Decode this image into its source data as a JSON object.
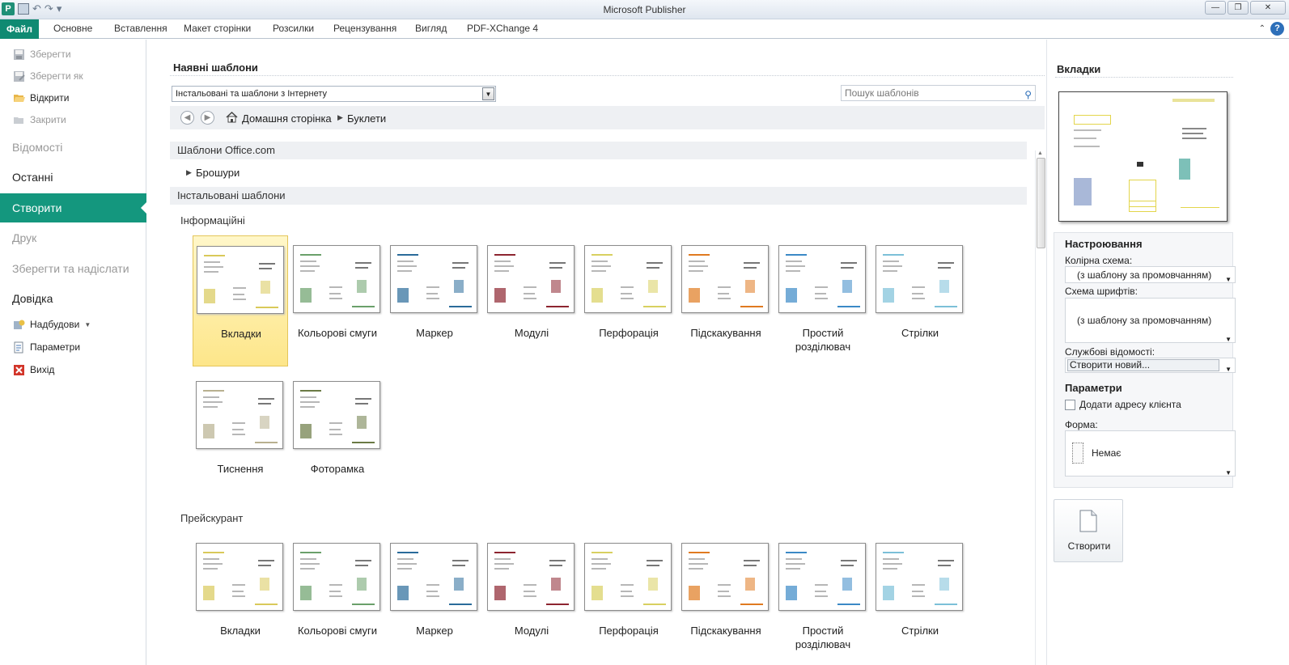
{
  "window": {
    "title": "Microsoft Publisher"
  },
  "ribbon": {
    "file_tab": "Файл",
    "tabs": [
      "Основне",
      "Вставлення",
      "Макет сторінки",
      "Розсилки",
      "Рецензування",
      "Вигляд",
      "PDF-XChange 4"
    ]
  },
  "leftnav": {
    "save": "Зберегти",
    "save_as": "Зберегти як",
    "open": "Відкрити",
    "close": "Закрити",
    "info": "Відомості",
    "recent": "Останні",
    "new": "Створити",
    "print": "Друк",
    "save_send": "Зберегти та надіслати",
    "help": "Довідка",
    "addins": "Надбудови",
    "options": "Параметри",
    "exit": "Вихід"
  },
  "main": {
    "title": "Наявні шаблони",
    "source_select": "Інстальовані та шаблони з Інтернету",
    "search_placeholder": "Пошук шаблонів",
    "breadcrumb": {
      "home": "Домашня сторінка",
      "current": "Буклети"
    },
    "office_section": "Шаблони Office.com",
    "brochures": "Брошури",
    "installed_section": "Інстальовані шаблони",
    "group_info": "Інформаційні",
    "group_price": "Прейскурант",
    "templates_info": [
      "Вкладки",
      "Кольорові смуги",
      "Маркер",
      "Модулі",
      "Перфорація",
      "Підскакування",
      "Простий розділювач",
      "Стрілки",
      "Тиснення",
      "Фоторамка"
    ],
    "templates_price": [
      "Вкладки",
      "Кольорові смуги",
      "Маркер",
      "Модулі",
      "Перфорація",
      "Підскакування",
      "Простий розділювач",
      "Стрілки"
    ],
    "selected_template": "Вкладки"
  },
  "rightpanel": {
    "title": "Вкладки",
    "settings_head": "Настроювання",
    "color_scheme_label": "Колірна схема:",
    "color_scheme_value": "(з шаблону за промовчанням)",
    "font_scheme_label": "Схема шрифтів:",
    "font_scheme_value": "(з шаблону за промовчанням)",
    "business_info_label": "Службові відомості:",
    "business_info_value": "Створити новий...",
    "params_head": "Параметри",
    "customer_address": "Додати адресу клієнта",
    "form_label": "Форма:",
    "form_value": "Немає",
    "create_button": "Створити"
  },
  "colors": {
    "accent": "#14977e",
    "file_tab": "#0f8a72",
    "selection": "#fde68a"
  }
}
